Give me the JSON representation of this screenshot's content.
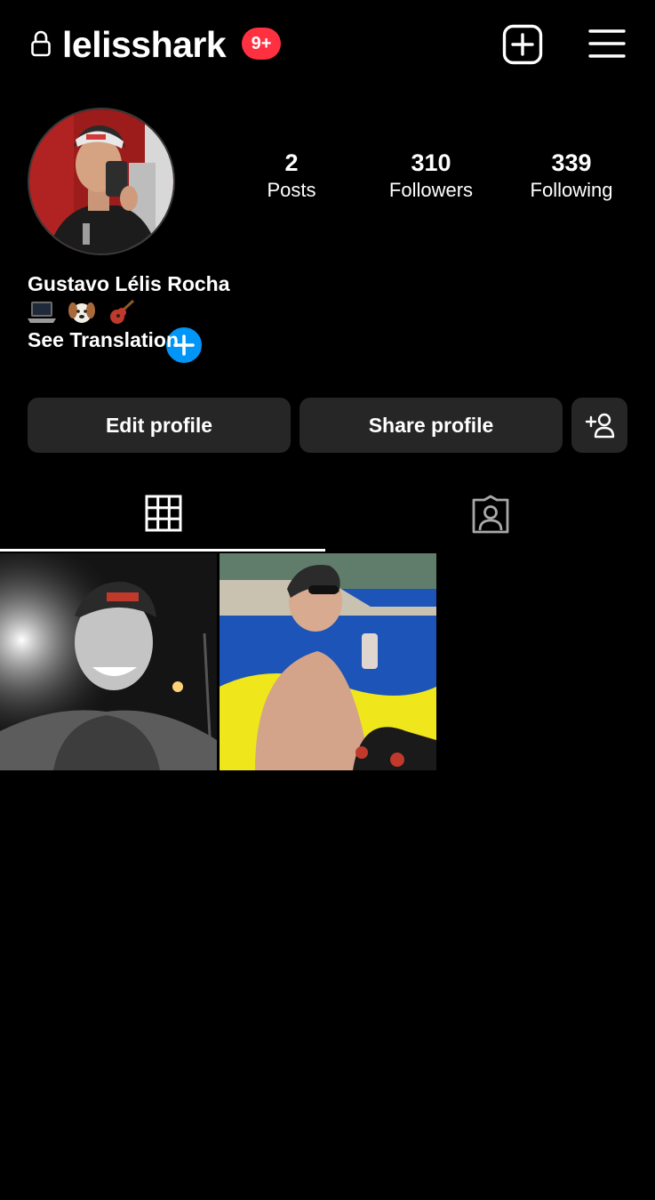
{
  "header": {
    "username": "lelisshark",
    "notifications_badge": "9+",
    "lock_icon": "lock-icon",
    "new_post_icon": "plus-square-icon",
    "menu_icon": "hamburger-menu-icon"
  },
  "profile": {
    "full_name": "Gustavo Lélis Rocha",
    "bio_emojis": [
      "laptop-icon",
      "dog-face-icon",
      "guitar-icon"
    ],
    "see_translation": "See Translation",
    "stats": {
      "posts": {
        "value": "2",
        "label": "Posts"
      },
      "followers": {
        "value": "310",
        "label": "Followers"
      },
      "following": {
        "value": "339",
        "label": "Following"
      }
    }
  },
  "actions": {
    "edit_profile": "Edit profile",
    "share_profile": "Share profile",
    "discover_people_icon": "add-person-icon"
  },
  "tabs": {
    "grid_icon": "grid-icon",
    "tagged_icon": "tagged-person-icon",
    "active": "grid"
  },
  "colors": {
    "background": "#000000",
    "button": "#262626",
    "badge": "#ff3040",
    "accent_blue": "#0095f6"
  }
}
